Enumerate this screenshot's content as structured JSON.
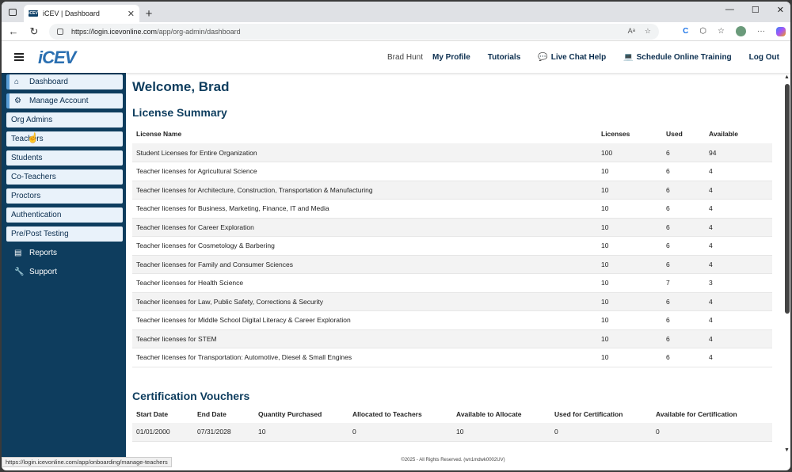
{
  "browser": {
    "tab_title": "iCEV | Dashboard",
    "favicon_text": "iCEV",
    "url_host": "https://login.icevonline.com",
    "url_path": "/app/org-admin/dashboard",
    "status_url": "https://login.icevonline.com/app/onboarding/manage-teachers"
  },
  "header": {
    "logo": "iCEV",
    "user_name": "Brad Hunt",
    "links": {
      "profile": "My Profile",
      "tutorials": "Tutorials",
      "chat": "Live Chat Help",
      "training": "Schedule Online Training",
      "logout": "Log Out"
    }
  },
  "sidebar": {
    "items": [
      {
        "label": "Dashboard"
      },
      {
        "label": "Manage Account"
      },
      {
        "label": "Org Admins"
      },
      {
        "label": "Teachers"
      },
      {
        "label": "Students"
      },
      {
        "label": "Co-Teachers"
      },
      {
        "label": "Proctors"
      },
      {
        "label": "Authentication"
      },
      {
        "label": "Pre/Post Testing"
      },
      {
        "label": "Reports"
      },
      {
        "label": "Support"
      }
    ]
  },
  "main": {
    "welcome": "Welcome, Brad",
    "license_title": "License Summary",
    "license_headers": [
      "License Name",
      "Licenses",
      "Used",
      "Available"
    ],
    "licenses": [
      [
        "Student Licenses for Entire Organization",
        "100",
        "6",
        "94"
      ],
      [
        "Teacher licenses for Agricultural Science",
        "10",
        "6",
        "4"
      ],
      [
        "Teacher licenses for Architecture, Construction, Transportation & Manufacturing",
        "10",
        "6",
        "4"
      ],
      [
        "Teacher licenses for Business, Marketing, Finance, IT and Media",
        "10",
        "6",
        "4"
      ],
      [
        "Teacher licenses for Career Exploration",
        "10",
        "6",
        "4"
      ],
      [
        "Teacher licenses for Cosmetology & Barbering",
        "10",
        "6",
        "4"
      ],
      [
        "Teacher licenses for Family and Consumer Sciences",
        "10",
        "6",
        "4"
      ],
      [
        "Teacher licenses for Health Science",
        "10",
        "7",
        "3"
      ],
      [
        "Teacher licenses for Law, Public Safety, Corrections & Security",
        "10",
        "6",
        "4"
      ],
      [
        "Teacher licenses for Middle School Digital Literacy & Career Exploration",
        "10",
        "6",
        "4"
      ],
      [
        "Teacher licenses for STEM",
        "10",
        "6",
        "4"
      ],
      [
        "Teacher licenses for Transportation: Automotive, Diesel & Small Engines",
        "10",
        "6",
        "4"
      ]
    ],
    "voucher_title": "Certification Vouchers",
    "voucher_headers": [
      "Start Date",
      "End Date",
      "Quantity Purchased",
      "Allocated to Teachers",
      "Available to Allocate",
      "Used for Certification",
      "Available for Certification"
    ],
    "vouchers": [
      [
        "01/01/2000",
        "07/31/2028",
        "10",
        "0",
        "10",
        "0",
        "0"
      ]
    ]
  },
  "footer": "©2025 - All Rights Reserved. (wn1mdwk0002UV)"
}
